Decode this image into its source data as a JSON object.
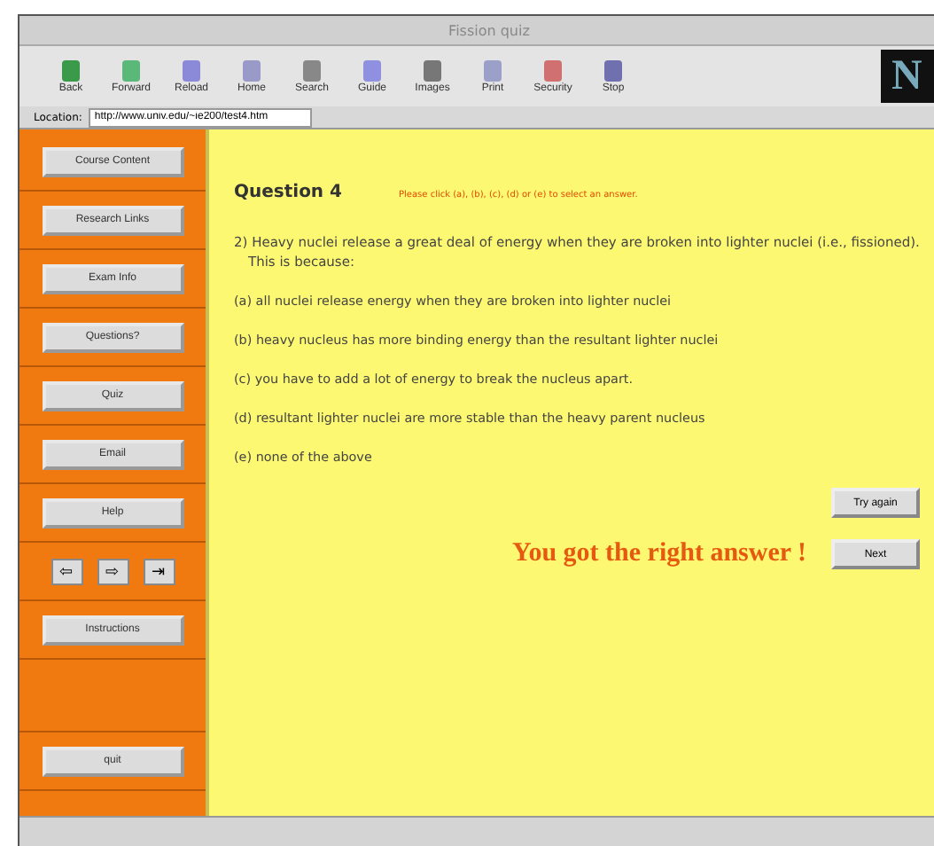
{
  "window": {
    "title": "Fission quiz"
  },
  "toolbar": [
    "Back",
    "Forward",
    "Reload",
    "Home",
    "Search",
    "Guide",
    "Images",
    "Print",
    "Security",
    "Stop"
  ],
  "logo": "N",
  "location": {
    "label": "Location:",
    "url": "http://www.univ.edu/~ie200/test4.htm"
  },
  "sidebar": [
    {
      "kind": "button",
      "label": "Course Content"
    },
    {
      "kind": "button",
      "label": "Research Links"
    },
    {
      "kind": "button",
      "label": "Exam Info"
    },
    {
      "kind": "button",
      "label": "Questions?"
    },
    {
      "kind": "button",
      "label": "Quiz"
    },
    {
      "kind": "button",
      "label": "Email"
    },
    {
      "kind": "button",
      "label": "Help"
    },
    {
      "kind": "arrows",
      "labels": [
        "⇦",
        "⇨",
        "⇥"
      ]
    },
    {
      "kind": "button",
      "label": "Instructions"
    },
    {
      "kind": "spacer"
    },
    {
      "kind": "button",
      "label": "quit"
    }
  ],
  "question": {
    "title": "Question 4",
    "instruction": "Please click (a), (b), (c), (d) or (e) to select an answer.",
    "text": "2) Heavy nuclei release a great deal of energy when they are broken into lighter nuclei (i.e., fissioned). This is because:",
    "options": [
      "(a) all nuclei release energy when they are broken into lighter nuclei",
      "(b) heavy nucleus has more binding energy than the resultant lighter nuclei",
      "(c) you have to add a lot of energy to break the nucleus apart.",
      "(d) resultant lighter nuclei are more stable than the heavy parent nucleus",
      "(e) none of the above"
    ]
  },
  "buttons": [
    "Try again",
    "Next"
  ],
  "feedback": "You got the right answer !"
}
